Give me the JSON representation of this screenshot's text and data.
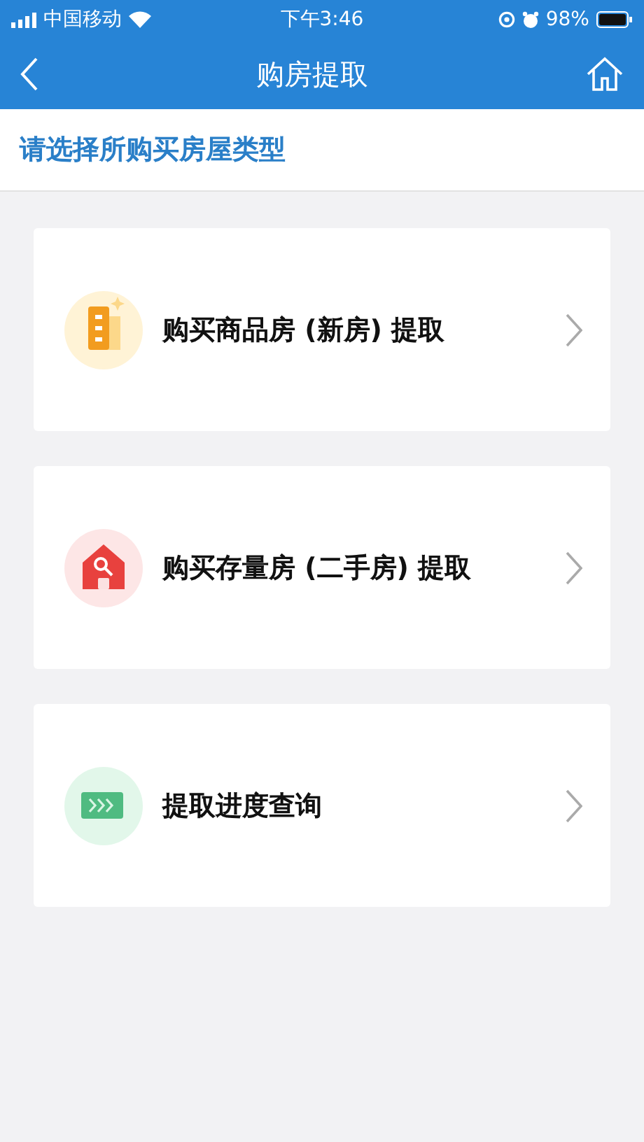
{
  "status_bar": {
    "carrier": "中国移动",
    "time": "下午3:46",
    "battery": "98%"
  },
  "nav": {
    "title": "购房提取"
  },
  "subtitle": "请选择所购买房屋类型",
  "options": [
    {
      "kind": "new-house",
      "label": "购买商品房 (新房) 提取"
    },
    {
      "kind": "used-house",
      "label": "购买存量房 (二手房) 提取"
    },
    {
      "kind": "progress",
      "label": "提取进度查询"
    }
  ]
}
